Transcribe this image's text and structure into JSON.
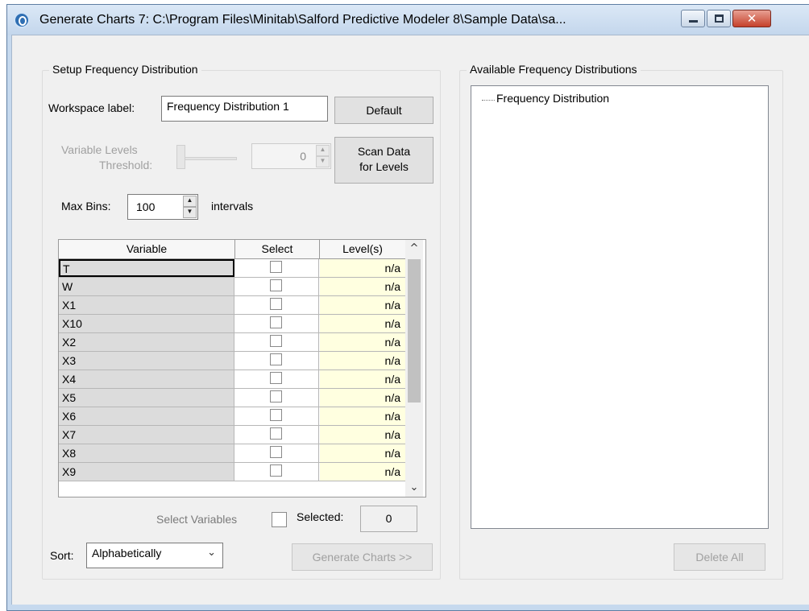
{
  "window": {
    "title": "Generate Charts 7: C:\\Program Files\\Minitab\\Salford Predictive Modeler 8\\Sample Data\\sa...",
    "close_glyph": "✕"
  },
  "setup": {
    "group_title": "Setup Frequency Distribution",
    "workspace_label": "Workspace label:",
    "workspace_value": "Frequency Distribution 1",
    "default_button": "Default",
    "variable_levels_label_1": "Variable Levels",
    "variable_levels_label_2": "Threshold:",
    "threshold_value": "0",
    "scan_button_1": "Scan Data",
    "scan_button_2": "for Levels",
    "max_bins_label": "Max Bins:",
    "max_bins_value": "100",
    "intervals_label": "intervals"
  },
  "grid": {
    "columns": [
      "Variable",
      "Select",
      "Level(s)"
    ],
    "rows": [
      {
        "variable": "T",
        "level": "n/a"
      },
      {
        "variable": "W",
        "level": "n/a"
      },
      {
        "variable": "X1",
        "level": "n/a"
      },
      {
        "variable": "X10",
        "level": "n/a"
      },
      {
        "variable": "X2",
        "level": "n/a"
      },
      {
        "variable": "X3",
        "level": "n/a"
      },
      {
        "variable": "X4",
        "level": "n/a"
      },
      {
        "variable": "X5",
        "level": "n/a"
      },
      {
        "variable": "X6",
        "level": "n/a"
      },
      {
        "variable": "X7",
        "level": "n/a"
      },
      {
        "variable": "X8",
        "level": "n/a"
      },
      {
        "variable": "X9",
        "level": "n/a"
      }
    ],
    "scroll_up": "^",
    "scroll_down": "⌄"
  },
  "footer": {
    "select_variables_label": "Select Variables",
    "selected_label": "Selected:",
    "selected_count": "0",
    "sort_label": "Sort:",
    "sort_value": "Alphabetically",
    "generate_button": "Generate Charts >>"
  },
  "available": {
    "group_title": "Available Frequency Distributions",
    "tree_items": [
      "Frequency Distribution"
    ],
    "delete_all_button": "Delete All"
  }
}
